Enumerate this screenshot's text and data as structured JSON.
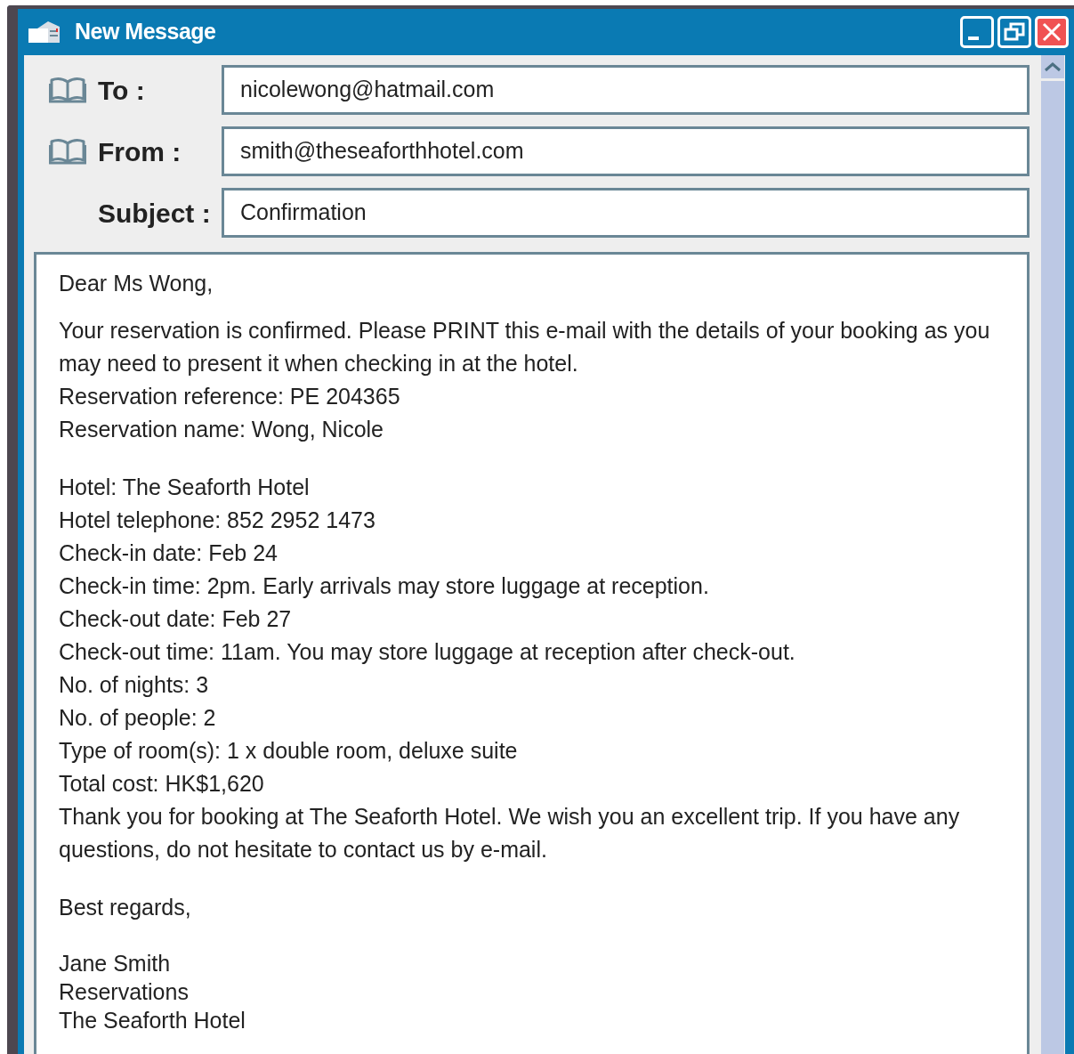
{
  "window": {
    "title": "New Message"
  },
  "header_fields": [
    {
      "label": "To :",
      "value": "nicolewong@hatmail.com",
      "has_icon": true
    },
    {
      "label": "From :",
      "value": "smith@theseaforthhotel.com",
      "has_icon": true
    },
    {
      "label": "Subject :",
      "value": "Confirmation",
      "has_icon": false
    }
  ],
  "body": {
    "blocks": [
      [
        "Dear Ms Wong,"
      ],
      [
        "Your reservation is confirmed. Please PRINT this e-mail with the details of your booking as you may need to present it when checking in at the hotel.",
        "Reservation reference: PE 204365",
        "Reservation name: Wong, Nicole"
      ],
      [
        "Hotel: The Seaforth Hotel",
        "Hotel telephone: 852 2952 1473",
        "Check-in date: Feb 24",
        "Check-in time: 2pm. Early arrivals may store luggage at reception.",
        "Check-out date: Feb 27",
        "Check-out time: 11am. You may store luggage at reception after check-out.",
        "No. of nights: 3",
        "No. of people: 2",
        "Type of room(s): 1 x double room, deluxe suite",
        "Total cost: HK$1,620",
        "Thank you for booking at The Seaforth Hotel. We wish you an excellent trip. If you have any questions, do not hesitate to contact us by e-mail."
      ],
      [
        "Best regards,"
      ],
      [
        "Jane Smith",
        "Reservations",
        "The Seaforth Hotel"
      ]
    ]
  }
}
